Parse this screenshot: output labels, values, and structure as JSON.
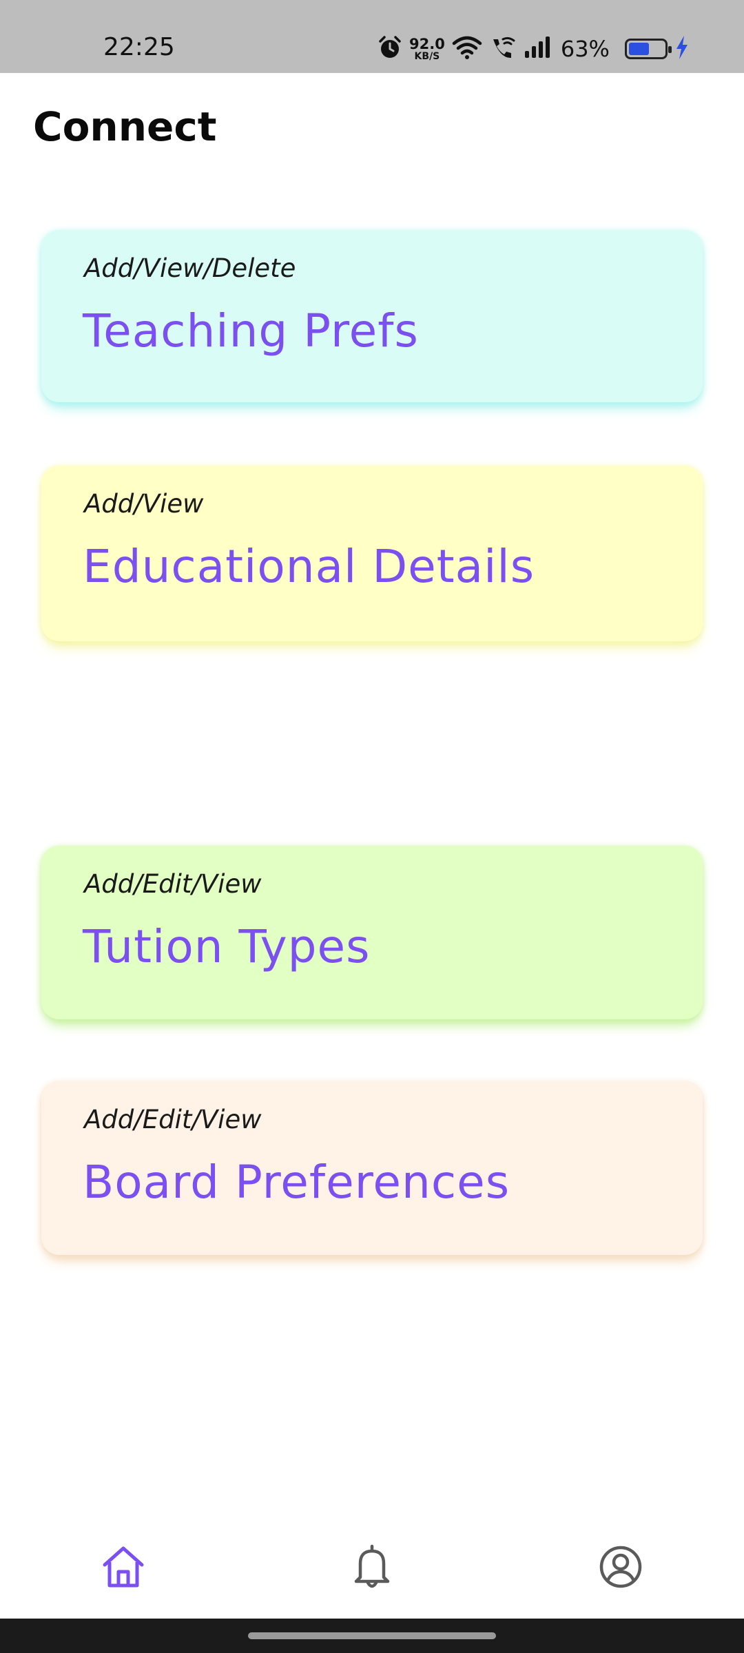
{
  "status_bar": {
    "time": "22:25",
    "net_speed_value": "92.0",
    "net_speed_unit": "KB/S",
    "battery_percent": "63%",
    "battery_level": 0.63,
    "icons": [
      "alarm-icon",
      "wifi-icon",
      "wifi-call-icon",
      "signal-icon",
      "battery-icon",
      "charging-icon"
    ]
  },
  "header": {
    "title": "Connect"
  },
  "cards": [
    {
      "subtitle": "Add/View/Delete",
      "title": "Teaching Prefs",
      "bg": "#d9fdf6",
      "shadow": "#aef3ee"
    },
    {
      "subtitle": "Add/View",
      "title": "Educational Details",
      "bg": "#ffffc6",
      "shadow": "#f5f5a8"
    },
    {
      "subtitle": "Add/Edit/View",
      "title": "Tution Types",
      "bg": "#e2ffc4",
      "shadow": "#c8f2a0"
    },
    {
      "subtitle": "Add/Edit/View",
      "title": "Board Preferences",
      "bg": "#fef3e6",
      "shadow": "#f5dcbf"
    }
  ],
  "bottom_nav": {
    "items": [
      {
        "icon": "home-icon",
        "active": true
      },
      {
        "icon": "bell-icon",
        "active": false
      },
      {
        "icon": "profile-icon",
        "active": false
      }
    ],
    "active_color": "#7b4ff0",
    "inactive_color": "#5a5a5a"
  }
}
